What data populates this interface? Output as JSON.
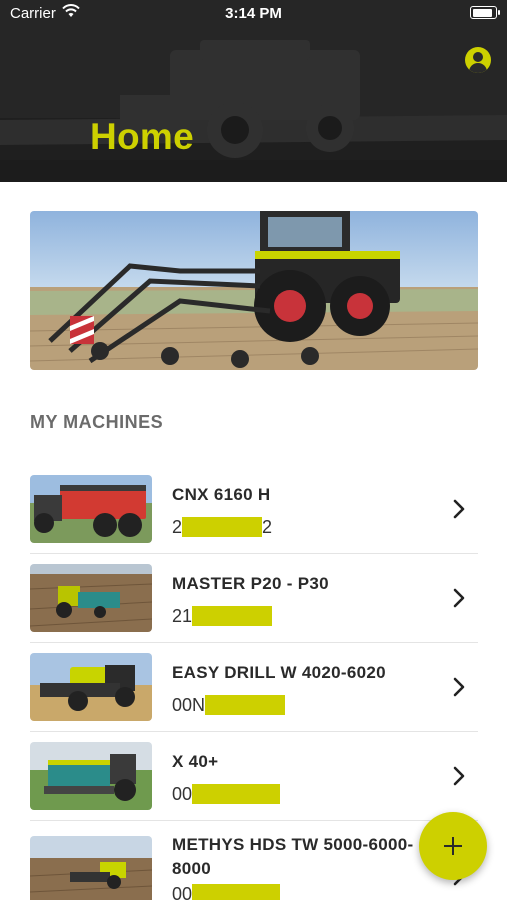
{
  "status_bar": {
    "carrier": "Carrier",
    "time": "3:14 PM"
  },
  "header": {
    "title": "Home",
    "account_icon": "account-circle-icon"
  },
  "section": {
    "title": "MY MACHINES"
  },
  "machines": [
    {
      "name": "CNX 6160 H",
      "serial_prefix": "2",
      "serial_suffix": "2",
      "redacted_fraction": 0.8
    },
    {
      "name": "MASTER P20 - P30",
      "serial_prefix": "21",
      "serial_suffix": "",
      "redacted_fraction": 0.8
    },
    {
      "name": "EASY DRILL W 4020-6020",
      "serial_prefix": "00N",
      "serial_suffix": "",
      "redacted_fraction": 0.8
    },
    {
      "name": "X 40+",
      "serial_prefix": "00",
      "serial_suffix": "",
      "redacted_fraction": 0.8
    },
    {
      "name": "METHYS HDS TW 5000-6000-8000",
      "serial_prefix": "00",
      "serial_suffix": "",
      "redacted_fraction": 0.8
    }
  ],
  "colors": {
    "accent": "#cdd000",
    "header_bg": "#222222",
    "text_dark": "#2a2a2a",
    "section_gray": "#6b6b6b"
  },
  "fab": {
    "icon": "plus-icon"
  }
}
